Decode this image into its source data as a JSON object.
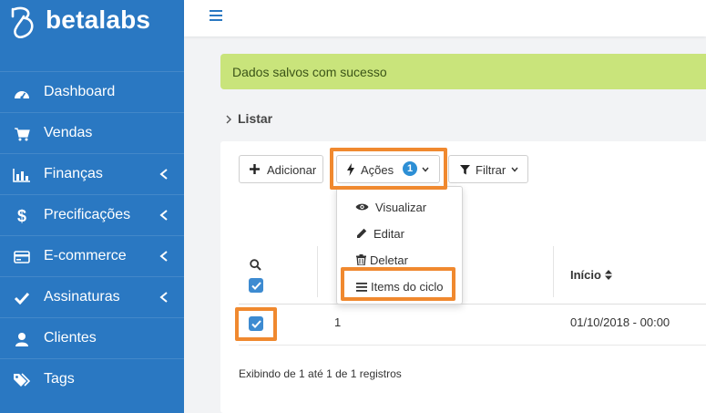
{
  "brand": {
    "name": "betalabs"
  },
  "sidebar": {
    "items": [
      {
        "label": "Dashboard",
        "icon": "dashboard-gauge-icon",
        "has_submenu": false
      },
      {
        "label": "Vendas",
        "icon": "shopping-cart-icon",
        "has_submenu": false
      },
      {
        "label": "Finanças",
        "icon": "bar-chart-icon",
        "has_submenu": true
      },
      {
        "label": "Precificações",
        "icon": "dollar-sign-icon",
        "has_submenu": true
      },
      {
        "label": "E-commerce",
        "icon": "credit-card-icon",
        "has_submenu": true
      },
      {
        "label": "Assinaturas",
        "icon": "check-icon",
        "has_submenu": true
      },
      {
        "label": "Clientes",
        "icon": "user-icon",
        "has_submenu": false
      },
      {
        "label": "Tags",
        "icon": "tags-icon",
        "has_submenu": false
      }
    ]
  },
  "alert": {
    "text": "Dados salvos com sucesso"
  },
  "breadcrumb": {
    "label": "Listar"
  },
  "toolbar": {
    "add_label": "Adicionar",
    "actions_label": "Ações",
    "actions_count": "1",
    "filter_label": "Filtrar"
  },
  "actions_menu": {
    "items": [
      {
        "label": "Visualizar",
        "icon": "eye-icon"
      },
      {
        "label": "Editar",
        "icon": "pencil-icon"
      },
      {
        "label": "Deletar",
        "icon": "trash-icon"
      },
      {
        "label": "Items do ciclo",
        "icon": "list-icon"
      }
    ]
  },
  "table": {
    "columns": [
      {
        "label": "Início"
      }
    ],
    "rows": [
      {
        "id": "1",
        "start": "01/10/2018 - 00:00",
        "selected": true
      }
    ]
  },
  "pagination": {
    "summary": "Exibindo de 1 até 1 de 1 registros"
  },
  "colors": {
    "sidebar": "#2a78c2",
    "alert_bg": "#c9e47b",
    "highlight": "#f0892f",
    "badge": "#2d8fd5",
    "checkbox": "#3d8bd1"
  }
}
